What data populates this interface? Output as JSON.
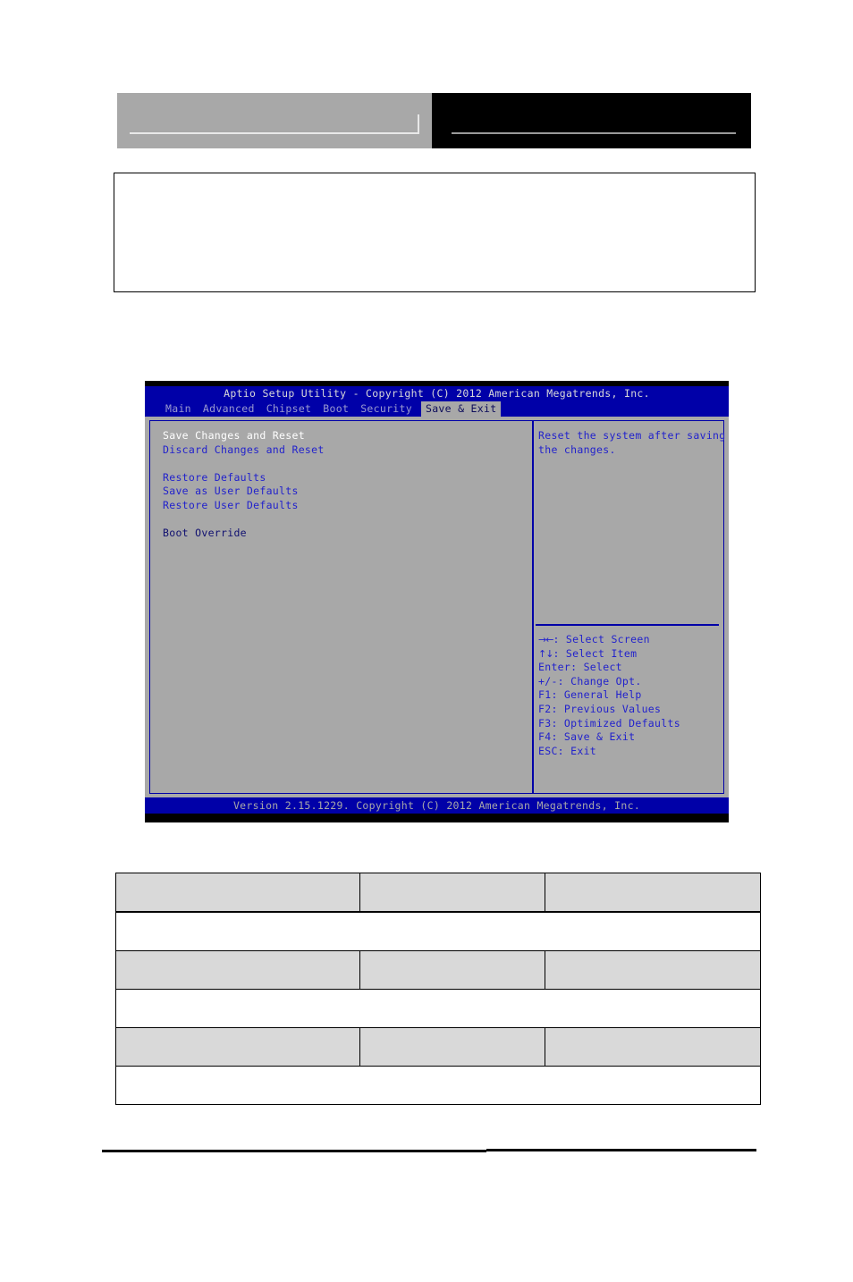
{
  "document": {
    "header": {
      "left_block_label": "redacted-logo-area",
      "right_block_label": "redacted-title-area"
    },
    "callout": {
      "content": ""
    },
    "table": {
      "columns": [
        "",
        "",
        ""
      ],
      "rows": [
        {
          "type": "columns",
          "cells": [
            "",
            "",
            ""
          ]
        },
        {
          "type": "full",
          "cells": [
            ""
          ]
        },
        {
          "type": "columns",
          "cells": [
            "",
            "",
            ""
          ]
        },
        {
          "type": "full",
          "cells": [
            ""
          ]
        },
        {
          "type": "columns",
          "cells": [
            "",
            "",
            ""
          ]
        },
        {
          "type": "full",
          "cells": [
            ""
          ]
        }
      ]
    }
  },
  "bios": {
    "title": "Aptio Setup Utility - Copyright (C) 2012 American Megatrends, Inc.",
    "menu": [
      {
        "label": "Main",
        "active": false
      },
      {
        "label": "Advanced",
        "active": false
      },
      {
        "label": "Chipset",
        "active": false
      },
      {
        "label": "Boot",
        "active": false
      },
      {
        "label": "Security",
        "active": false
      },
      {
        "label": "Save & Exit",
        "active": true
      }
    ],
    "items": [
      {
        "label": "Save Changes and Reset",
        "style": "selected"
      },
      {
        "label": "Discard Changes and Reset",
        "style": "normal"
      },
      {
        "label": "",
        "style": "spacer"
      },
      {
        "label": "Restore Defaults",
        "style": "normal"
      },
      {
        "label": "Save as User Defaults",
        "style": "normal"
      },
      {
        "label": "Restore User Defaults",
        "style": "normal"
      },
      {
        "label": "",
        "style": "spacer"
      },
      {
        "label": "Boot Override",
        "style": "plain"
      }
    ],
    "help": [
      "Reset the system after saving",
      "the changes."
    ],
    "keys": [
      {
        "glyph": "→←",
        "text": ": Select Screen"
      },
      {
        "glyph": "↑↓",
        "text": ": Select Item"
      },
      {
        "glyph": "",
        "text": "Enter: Select"
      },
      {
        "glyph": "",
        "text": "+/-: Change Opt."
      },
      {
        "glyph": "",
        "text": "F1: General Help"
      },
      {
        "glyph": "",
        "text": "F2: Previous Values"
      },
      {
        "glyph": "",
        "text": "F3: Optimized Defaults"
      },
      {
        "glyph": "",
        "text": "F4: Save & Exit"
      },
      {
        "glyph": "",
        "text": "ESC: Exit"
      }
    ],
    "version": "Version 2.15.1229. Copyright (C) 2012 American Megatrends, Inc.",
    "colors": {
      "title_bar": "#0000a8",
      "panel_background": "#a8a8a8",
      "item_text": "#2222cc",
      "selected_text": "#ffffff",
      "plain_text": "#101070",
      "active_tab_background": "#a8a8a8",
      "active_tab_text": "#0c0c5a",
      "footer_text": "#a8a8a8"
    }
  }
}
